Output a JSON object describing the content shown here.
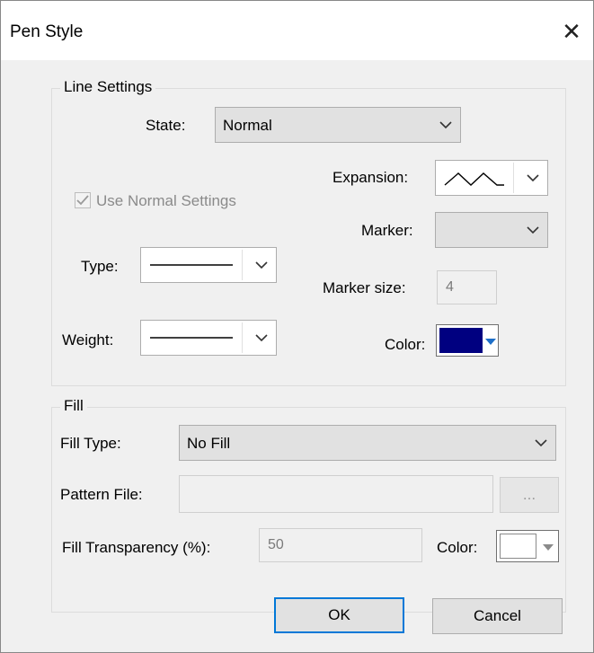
{
  "window": {
    "title": "Pen Style"
  },
  "icons": {
    "close": "close-icon",
    "chevron": "chevron-down-icon",
    "checkbox": "checkbox-checked-icon"
  },
  "line_settings": {
    "legend": "Line Settings",
    "state": {
      "label": "State:",
      "value": "Normal"
    },
    "use_normal": {
      "label": "Use Normal Settings",
      "checked": true,
      "enabled": false
    },
    "type": {
      "label": "Type:",
      "value": "solid-line"
    },
    "weight": {
      "label": "Weight:",
      "value": "thin-line"
    },
    "expansion": {
      "label": "Expansion:",
      "value": "zigzag-line"
    },
    "marker": {
      "label": "Marker:",
      "value": ""
    },
    "marker_size": {
      "label": "Marker size:",
      "value": "4"
    },
    "color": {
      "label": "Color:",
      "value": "#000080"
    }
  },
  "fill": {
    "legend": "Fill",
    "fill_type": {
      "label": "Fill Type:",
      "value": "No Fill"
    },
    "pattern_file": {
      "label": "Pattern File:",
      "value": "",
      "browse_label": "..."
    },
    "transparency": {
      "label": "Fill Transparency (%):",
      "value": "50"
    },
    "color": {
      "label": "Color:",
      "value": "#ffffff"
    }
  },
  "buttons": {
    "ok": "OK",
    "cancel": "Cancel"
  }
}
